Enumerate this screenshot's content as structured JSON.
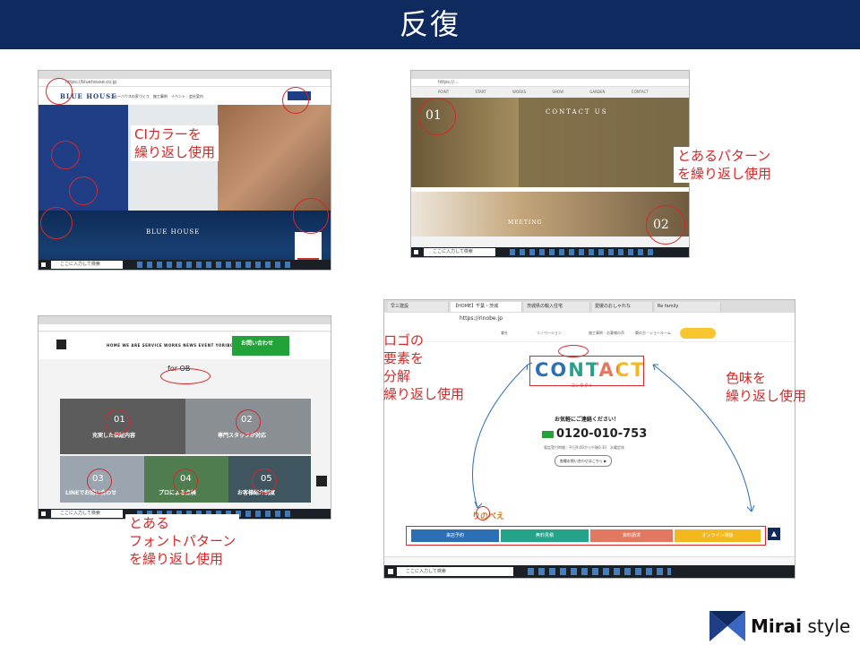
{
  "slide": {
    "title": "反復"
  },
  "shot1": {
    "url": "https://bluehouse.co.jp",
    "logo": "BLUE HOUSE",
    "nav": "ブルーハウスの家づくり　施工事例　イベント　会社案内　",
    "footer_title": "BLUE HOUSE",
    "show_room": "SHOW ROOM",
    "annotation": "CIカラーを\n繰り返し使用",
    "taskbar_search": "ここに入力して検索"
  },
  "shot2": {
    "url": "https://...",
    "nav": "POINT START WORKS SHOW GARDEN CONTACT",
    "contact": "CONTACT US",
    "num1": "01",
    "num2": "02",
    "meeting": "MEETING",
    "annotation": "とあるパターン\nを繰り返し使用",
    "taskbar_search": "ここに入力して検索"
  },
  "shot3": {
    "menu": "HOME WE ARE SERVICE WORKS NEWS EVENT YORIBOND SHOP",
    "cta": "お問い合わせ",
    "for_ob": "for OB",
    "tiles": [
      {
        "num": "01",
        "caption": "充実した保証内容",
        "color": "#5c5c5c"
      },
      {
        "num": "02",
        "caption": "専門スタッフが対応",
        "color": "#8a8f94"
      },
      {
        "num": "03",
        "caption": "LINEでお問い合わせ",
        "color": "#9aa5b0"
      },
      {
        "num": "04",
        "caption": "プロによる点検",
        "color": "#4f7d4f"
      },
      {
        "num": "05",
        "caption": "お客様紹介制度",
        "color": "#3f5660"
      }
    ],
    "annotation": "とある\nフォントパターン\nを繰り返し使用",
    "taskbar_search": "ここに入力して検索"
  },
  "shot4": {
    "tabs": [
      "早三建設",
      "【HOME】千葉・茨城",
      "茨城県の輸入住宅",
      "愛媛のおしゃれな",
      "Re family"
    ],
    "url": "https://rinobe.jp",
    "menu": [
      "會社",
      "リノベーション",
      "施工事例・お客様の声",
      "築の方・ショールーム"
    ],
    "contact": "CONTACT",
    "contact_sub": "コンタクト",
    "call": "お気軽にご連絡ください！",
    "tel": "0120-010-753",
    "hours": "電話受付時間｜平日9:00から午後6:30　水曜定休",
    "form": "各種お問い合わせはこちら ▶",
    "logo": "りのべえ",
    "buttons": [
      {
        "label": "来店予約",
        "color": "#2d6fb5"
      },
      {
        "label": "無料見積",
        "color": "#25a38a"
      },
      {
        "label": "資料請求",
        "color": "#e2785f"
      },
      {
        "label": "オンライン相談",
        "color": "#f2b81e"
      }
    ],
    "top": "▲",
    "taskbar_search": "ここに入力して検索",
    "annotation_left": "ロゴの\n要素を\n分解\n繰り返し使用",
    "annotation_right": "色味を\n繰り返し使用"
  },
  "brand": {
    "name_bold": "Mirai",
    "name": " style"
  },
  "colors": {
    "header": "#0f2a5e",
    "accent": "#d62828"
  }
}
